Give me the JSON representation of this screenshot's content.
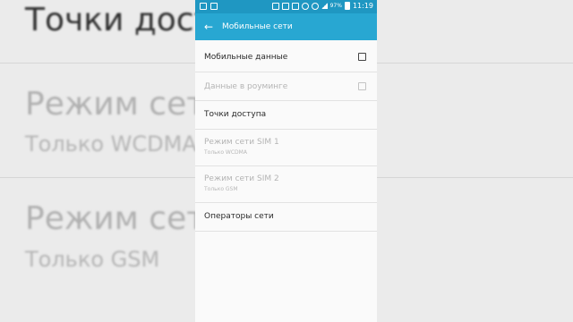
{
  "background": {
    "title": "Точки доступа",
    "item1_title": "Режим сети S",
    "item1_sub": "Только WCDMA",
    "item2_title": "Режим сети S",
    "item2_sub": "Только GSM"
  },
  "statusbar": {
    "battery": "97%",
    "time": "11:19"
  },
  "appbar": {
    "back_icon": "arrow-back-icon",
    "title": "Мобильные сети"
  },
  "settings": [
    {
      "title": "Мобильные данные",
      "checkbox": true,
      "checked": false,
      "enabled": true
    },
    {
      "title": "Данные в роуминге",
      "checkbox": true,
      "checked": false,
      "enabled": false
    },
    {
      "title": "Точки доступа",
      "enabled": true
    },
    {
      "title": "Режим сети SIM 1",
      "subtitle": "Только WCDMA",
      "enabled": false
    },
    {
      "title": "Режим сети SIM 2",
      "subtitle": "Только GSM",
      "enabled": false
    },
    {
      "title": "Операторы сети",
      "enabled": true
    }
  ],
  "colors": {
    "statusbar": "#1f97c2",
    "appbar": "#28a7d2",
    "text": "#2a2a2a",
    "disabled_text": "#b4b4b4"
  }
}
